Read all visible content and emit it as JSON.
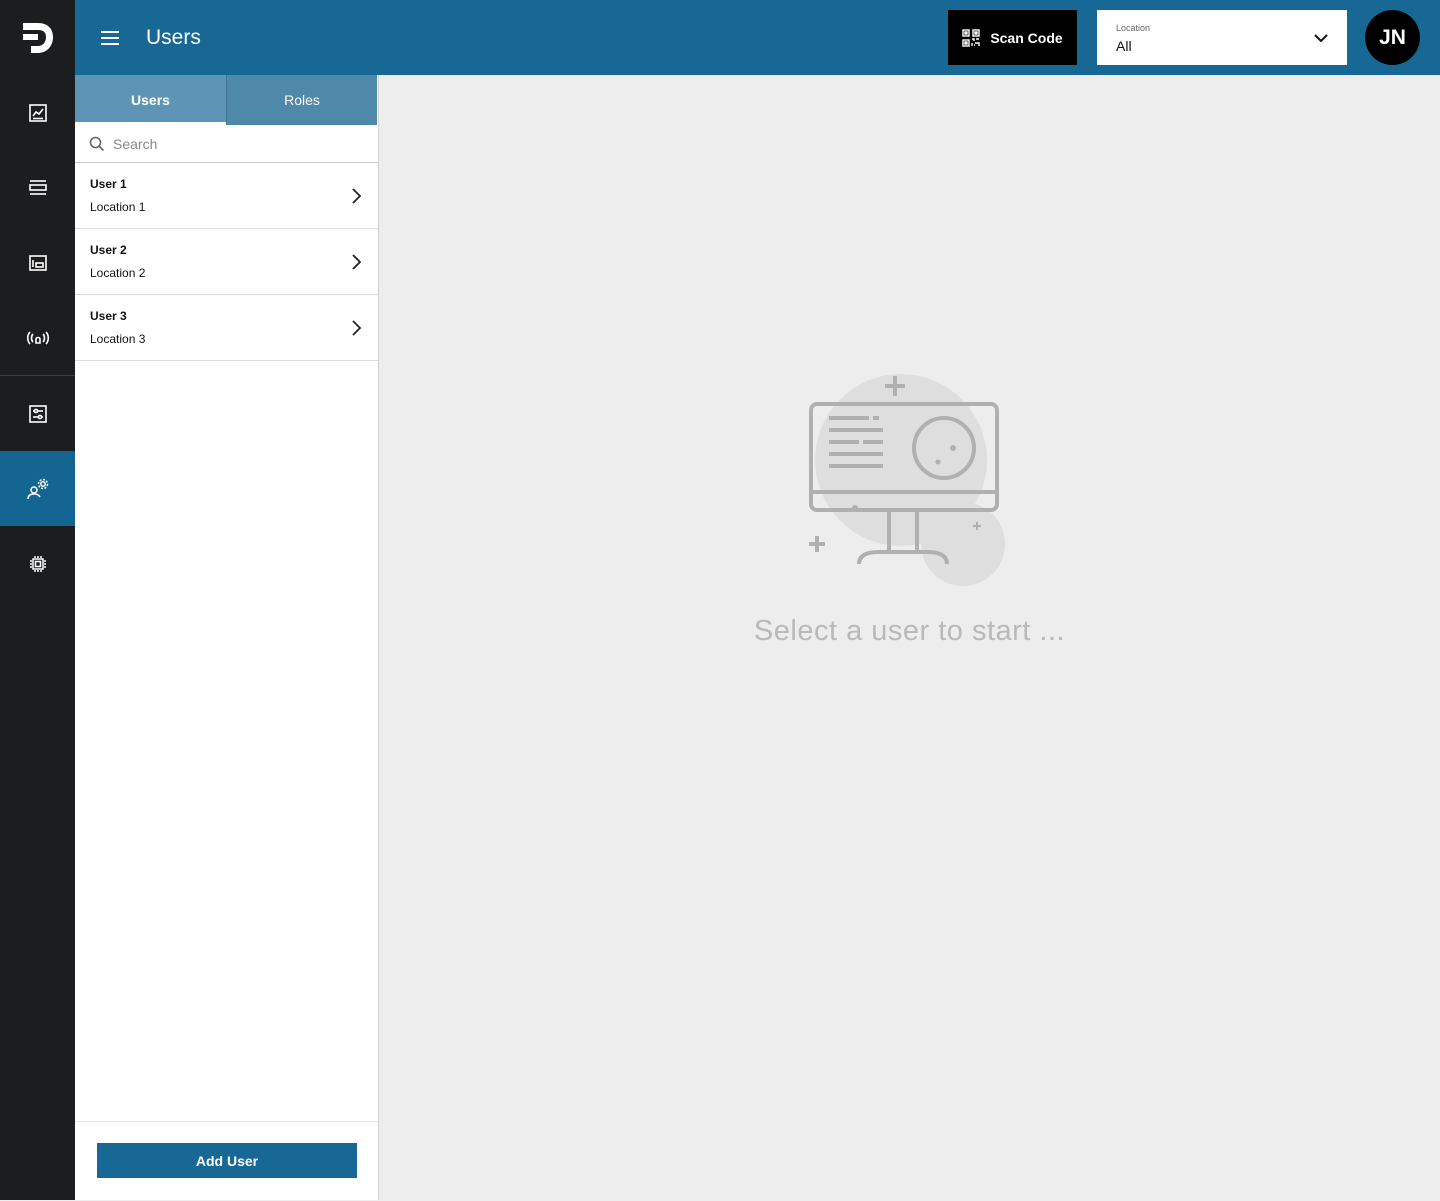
{
  "header": {
    "title": "Users",
    "scan_button": "Scan Code",
    "location": {
      "label": "Location",
      "value": "All"
    },
    "avatar_initials": "JN"
  },
  "sidebar": {
    "items": [
      {
        "icon": "dashboard-icon"
      },
      {
        "icon": "list-icon"
      },
      {
        "icon": "device-icon"
      },
      {
        "icon": "broadcast-icon"
      },
      {
        "icon": "settings-panel-icon"
      },
      {
        "icon": "user-settings-icon",
        "active": true
      },
      {
        "icon": "chip-icon"
      }
    ]
  },
  "list_panel": {
    "tabs": [
      {
        "label": "Users",
        "active": true
      },
      {
        "label": "Roles",
        "active": false
      }
    ],
    "search_placeholder": "Search",
    "users": [
      {
        "name": "User 1",
        "location": "Location 1"
      },
      {
        "name": "User 2",
        "location": "Location 2"
      },
      {
        "name": "User 3",
        "location": "Location 3"
      }
    ],
    "add_button": "Add User"
  },
  "main": {
    "empty_message": "Select a user to start ..."
  },
  "colors": {
    "header": "#186895",
    "sidebar": "#1c1d1f",
    "sidebar_active": "#156592",
    "tabs": "#4f89aa",
    "button": "#186895"
  }
}
